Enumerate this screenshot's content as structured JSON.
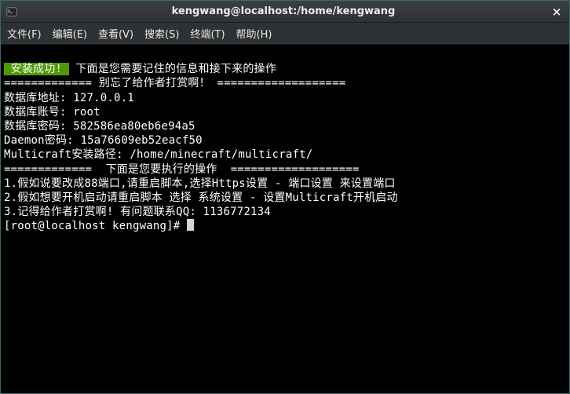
{
  "window": {
    "title": "kengwang@localhost:/home/kengwang",
    "close_glyph": "×"
  },
  "menu": {
    "file": "文件(F)",
    "edit": "编辑(E)",
    "view": "查看(V)",
    "search": "搜索(S)",
    "terminal": "终端(T)",
    "help": "帮助(H)"
  },
  "output": {
    "success_label": " 安装成功! ",
    "success_rest": " 下面是您需要记住的信息和接下来的操作",
    "divider1_left": "============= ",
    "divider1_text": "别忘了给作者打赏啊！",
    "divider1_right": " ===================",
    "db_addr_label": "数据库地址: ",
    "db_addr_value": "127.0.0.1",
    "db_user_label": "数据库账号: ",
    "db_user_value": "root",
    "db_pass_label": "数据库密码: ",
    "db_pass_value": "582586ea80eb6e94a5",
    "daemon_pass_label": "Daemon密码: ",
    "daemon_pass_value": "15a76609eb52eacf50",
    "install_path_label": "Multicraft安装路径: ",
    "install_path_value": "/home/minecraft/multicraft/",
    "divider2_left": "=============  ",
    "divider2_text": "下面是您要执行的操作",
    "divider2_right": "  ===================",
    "step1": "1.假如说要改成88端口,请重启脚本,选择Https设置 - 端口设置 来设置端口",
    "step2": "2.假如想要开机启动请重启脚本 选择 系统设置 - 设置Multicraft开机启动",
    "step3": "3.记得给作者打赏啊! 有问题联系QQ: 1136772134",
    "prompt": "[root@localhost kengwang]# "
  }
}
